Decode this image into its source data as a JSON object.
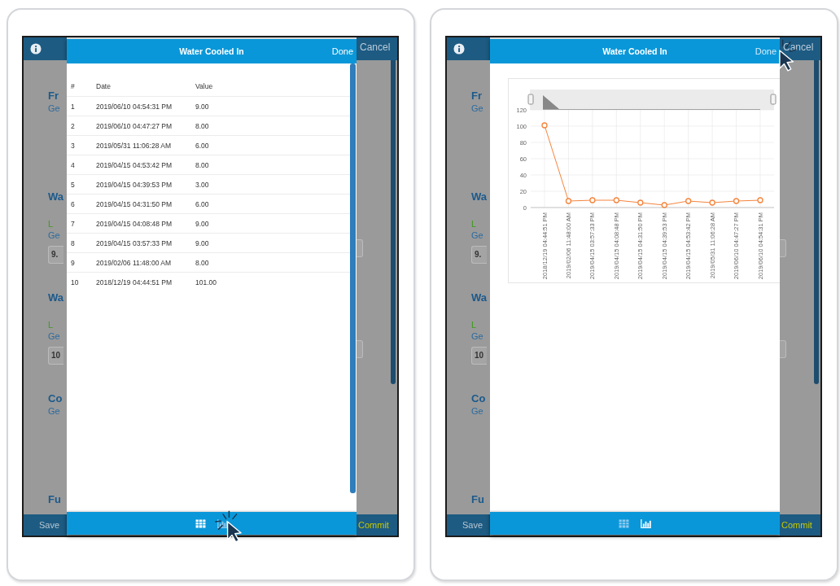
{
  "panels": [
    {
      "app": {
        "cancel": "Cancel",
        "save": "Save",
        "commit": "Commit",
        "sections": [
          {
            "items": [
              {
                "kind": "heading",
                "text": "Fr"
              },
              {
                "kind": "sub",
                "text": "Ge"
              }
            ]
          },
          {
            "items": [
              {
                "kind": "heading",
                "text": "Wa"
              },
              {
                "kind": "label",
                "text": "L"
              },
              {
                "kind": "sub",
                "text": "Ge"
              },
              {
                "kind": "field",
                "text": "9."
              }
            ]
          },
          {
            "items": [
              {
                "kind": "heading",
                "text": "Wa"
              },
              {
                "kind": "label",
                "text": "L"
              },
              {
                "kind": "sub",
                "text": "Ge"
              },
              {
                "kind": "field",
                "text": "10"
              }
            ]
          },
          {
            "items": [
              {
                "kind": "heading",
                "text": "Co"
              },
              {
                "kind": "sub",
                "text": "Ge"
              }
            ]
          },
          {
            "items": [
              {
                "kind": "heading",
                "text": "Fu"
              }
            ]
          }
        ]
      },
      "modal": {
        "title": "Water Cooled In",
        "done": {
          "text": "Done",
          "pressed": false
        },
        "views": [
          {
            "kind": "table",
            "selected": true,
            "pressed": false
          },
          {
            "kind": "chart",
            "selected": false,
            "pressed": true
          }
        ],
        "table": {
          "columns": [
            "#",
            "Date",
            "Value"
          ],
          "rows": [
            [
              "1",
              "2019/06/10 04:54:31 PM",
              "9.00"
            ],
            [
              "2",
              "2019/06/10 04:47:27 PM",
              "8.00"
            ],
            [
              "3",
              "2019/05/31 11:06:28 AM",
              "6.00"
            ],
            [
              "4",
              "2019/04/15 04:53:42 PM",
              "8.00"
            ],
            [
              "5",
              "2019/04/15 04:39:53 PM",
              "3.00"
            ],
            [
              "6",
              "2019/04/15 04:31:50 PM",
              "6.00"
            ],
            [
              "7",
              "2019/04/15 04:08:48 PM",
              "9.00"
            ],
            [
              "8",
              "2019/04/15 03:57:33 PM",
              "9.00"
            ],
            [
              "9",
              "2019/02/06 11:48:00 AM",
              "8.00"
            ],
            [
              "10",
              "2018/12/19 04:44:51 PM",
              "101.00"
            ]
          ]
        }
      }
    },
    {
      "app": {
        "cancel": "Cancel",
        "save": "Save",
        "commit": "Commit",
        "sections": [
          {
            "items": [
              {
                "kind": "heading",
                "text": "Fr"
              },
              {
                "kind": "sub",
                "text": "Ge"
              }
            ]
          },
          {
            "items": [
              {
                "kind": "heading",
                "text": "Wa"
              },
              {
                "kind": "label",
                "text": "L"
              },
              {
                "kind": "sub",
                "text": "Ge"
              },
              {
                "kind": "field",
                "text": "9."
              }
            ]
          },
          {
            "items": [
              {
                "kind": "heading",
                "text": "Wa"
              },
              {
                "kind": "label",
                "text": "L"
              },
              {
                "kind": "sub",
                "text": "Ge"
              },
              {
                "kind": "field",
                "text": "10"
              }
            ]
          },
          {
            "items": [
              {
                "kind": "heading",
                "text": "Co"
              },
              {
                "kind": "sub",
                "text": "Ge"
              }
            ]
          },
          {
            "items": [
              {
                "kind": "heading",
                "text": "Fu"
              }
            ]
          }
        ]
      },
      "modal": {
        "title": "Water Cooled In",
        "done": {
          "text": "Done",
          "pressed": true
        },
        "views": [
          {
            "kind": "table",
            "selected": false,
            "pressed": false
          },
          {
            "kind": "chart",
            "selected": true,
            "pressed": false
          }
        ],
        "chart_data": {
          "type": "line",
          "categories": [
            "2018/12/19 04:44:51 PM",
            "2019/02/06 11:48:00 AM",
            "2019/04/15 03:57:33 PM",
            "2019/04/15 04:08:48 PM",
            "2019/04/15 04:31:50 PM",
            "2019/04/15 04:39:53 PM",
            "2019/04/15 04:53:42 PM",
            "2019/05/31 11:06:28 AM",
            "2019/06/10 04:47:27 PM",
            "2019/06/10 04:54:31 PM"
          ],
          "series": [
            {
              "color": "#f5843c",
              "marker": true,
              "values": [
                101,
                8,
                9,
                9,
                6,
                3,
                8,
                6,
                8,
                9
              ]
            }
          ],
          "ylim": [
            0,
            120
          ],
          "yticks": [
            0,
            20,
            40,
            60,
            80,
            100,
            120
          ],
          "grid": true
        }
      }
    }
  ]
}
